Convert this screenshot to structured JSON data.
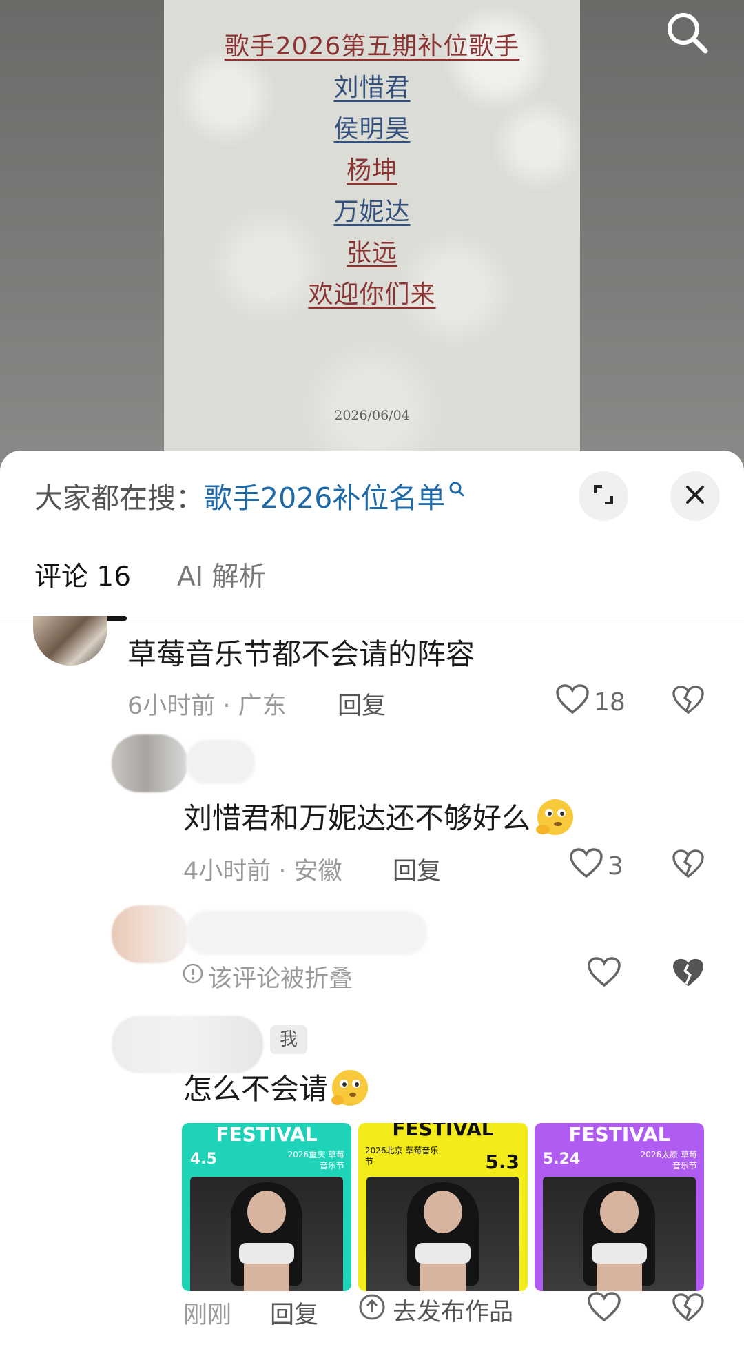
{
  "post": {
    "title": "歌手2026第五期补位歌手",
    "names": [
      "刘惜君",
      "侯明昊",
      "杨坤",
      "万妮达",
      "张远"
    ],
    "closing": "欢迎你们来",
    "date": "2026/06/04"
  },
  "sheet": {
    "hot_search_label": "大家都在搜：",
    "hot_search_term": "歌手2026补位名单"
  },
  "tabs": {
    "comments": "评论 16",
    "ai": "AI 解析"
  },
  "comments": [
    {
      "text": "草莓音乐节都不会请的阵容",
      "time_loc": "6小时前 · 广东",
      "reply": "回复",
      "likes": "18"
    },
    {
      "text": "刘惜君和万妮达还不够好么",
      "emoji": "thinking-emoji",
      "time_loc": "4小时前 · 安徽",
      "reply": "回复",
      "likes": "3"
    },
    {
      "folded_text": "该评论被折叠"
    },
    {
      "badge": "我",
      "text": "怎么不会请",
      "emoji": "thinking-emoji",
      "time": "刚刚",
      "reply": "回复",
      "publish": "去发布作品",
      "images": [
        {
          "title": "FESTIVAL",
          "date": "4.5",
          "sub": "2026重庆 草莓音乐节",
          "bg": "#1fd3b8"
        },
        {
          "title": "FESTIVAL",
          "date": "5.3",
          "sub": "2026北京 草莓音乐节",
          "bg": "#f4ec1a"
        },
        {
          "title": "FESTIVAL",
          "date": "5.24",
          "sub": "2026太原 草莓音乐节",
          "bg": "#b05cf0"
        }
      ]
    }
  ],
  "colors": {
    "link_blue": "#1e6aa8",
    "post_red": "#8a3434",
    "post_blue": "#34507d"
  }
}
